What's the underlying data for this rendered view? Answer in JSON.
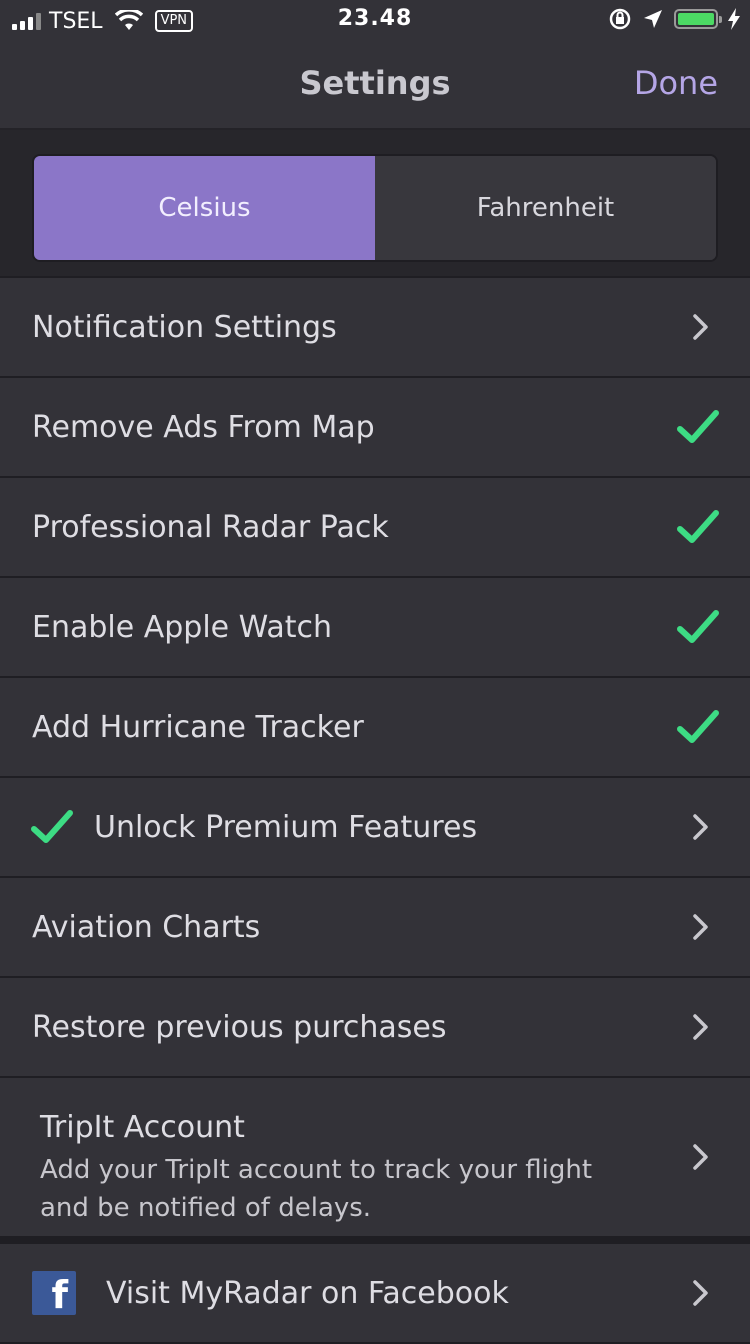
{
  "status_bar": {
    "carrier": "TSEL",
    "vpn": "VPN",
    "time": "23.48",
    "battery_level": 1.0,
    "icons": [
      "signal-bars-icon",
      "wifi-icon",
      "rotation-lock-icon",
      "location-arrow-icon",
      "battery-icon",
      "charging-bolt-icon"
    ]
  },
  "nav": {
    "title": "Settings",
    "done_label": "Done"
  },
  "units": {
    "options": [
      "Celsius",
      "Fahrenheit"
    ],
    "selected": "Celsius"
  },
  "rows": [
    {
      "label": "Notification Settings",
      "accessory": "chevron"
    },
    {
      "label": "Remove Ads From Map",
      "accessory": "check"
    },
    {
      "label": "Professional Radar Pack",
      "accessory": "check"
    },
    {
      "label": "Enable Apple Watch",
      "accessory": "check"
    },
    {
      "label": "Add Hurricane Tracker",
      "accessory": "check"
    },
    {
      "label": "Unlock Premium Features",
      "accessory": "chevron",
      "leading": "check"
    },
    {
      "label": "Aviation Charts",
      "accessory": "chevron"
    },
    {
      "label": "Restore previous purchases",
      "accessory": "chevron"
    }
  ],
  "tripit": {
    "title": "TripIt Account",
    "description": "Add your TripIt account to track your flight and be notified of delays."
  },
  "facebook": {
    "label": "Visit MyRadar on Facebook",
    "icon_letter": "f"
  },
  "colors": {
    "accent": "#8b76c8",
    "done": "#b5a6e6",
    "check": "#3ddc84",
    "background": "#333238",
    "facebook": "#3b5998"
  }
}
